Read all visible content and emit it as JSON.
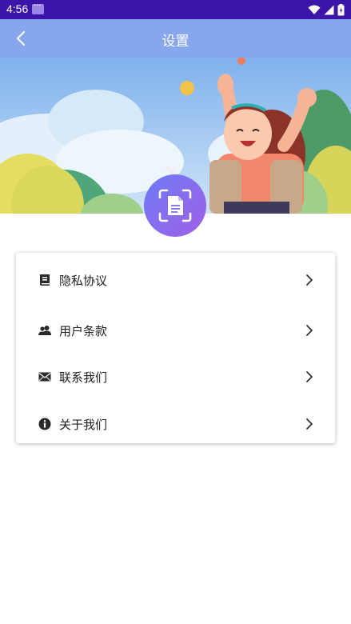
{
  "status_bar": {
    "time": "4:56",
    "icons": [
      "app-notification-icon",
      "wifi-icon",
      "signal-icon",
      "battery-icon"
    ]
  },
  "app_bar": {
    "title": "设置",
    "back_icon": "chevron-left-icon"
  },
  "badge": {
    "icon": "document-scan-icon"
  },
  "menu": {
    "items": [
      {
        "label": "隐私协议",
        "icon": "book-icon"
      },
      {
        "label": "用户条款",
        "icon": "users-icon"
      },
      {
        "label": "联系我们",
        "icon": "mail-icon"
      },
      {
        "label": "关于我们",
        "icon": "info-icon"
      }
    ]
  },
  "colors": {
    "status_bar": "#3b14a8",
    "app_bar": "#86a6ee",
    "badge_gradient_start": "#6b7cf5",
    "badge_gradient_end": "#a35fe6"
  }
}
